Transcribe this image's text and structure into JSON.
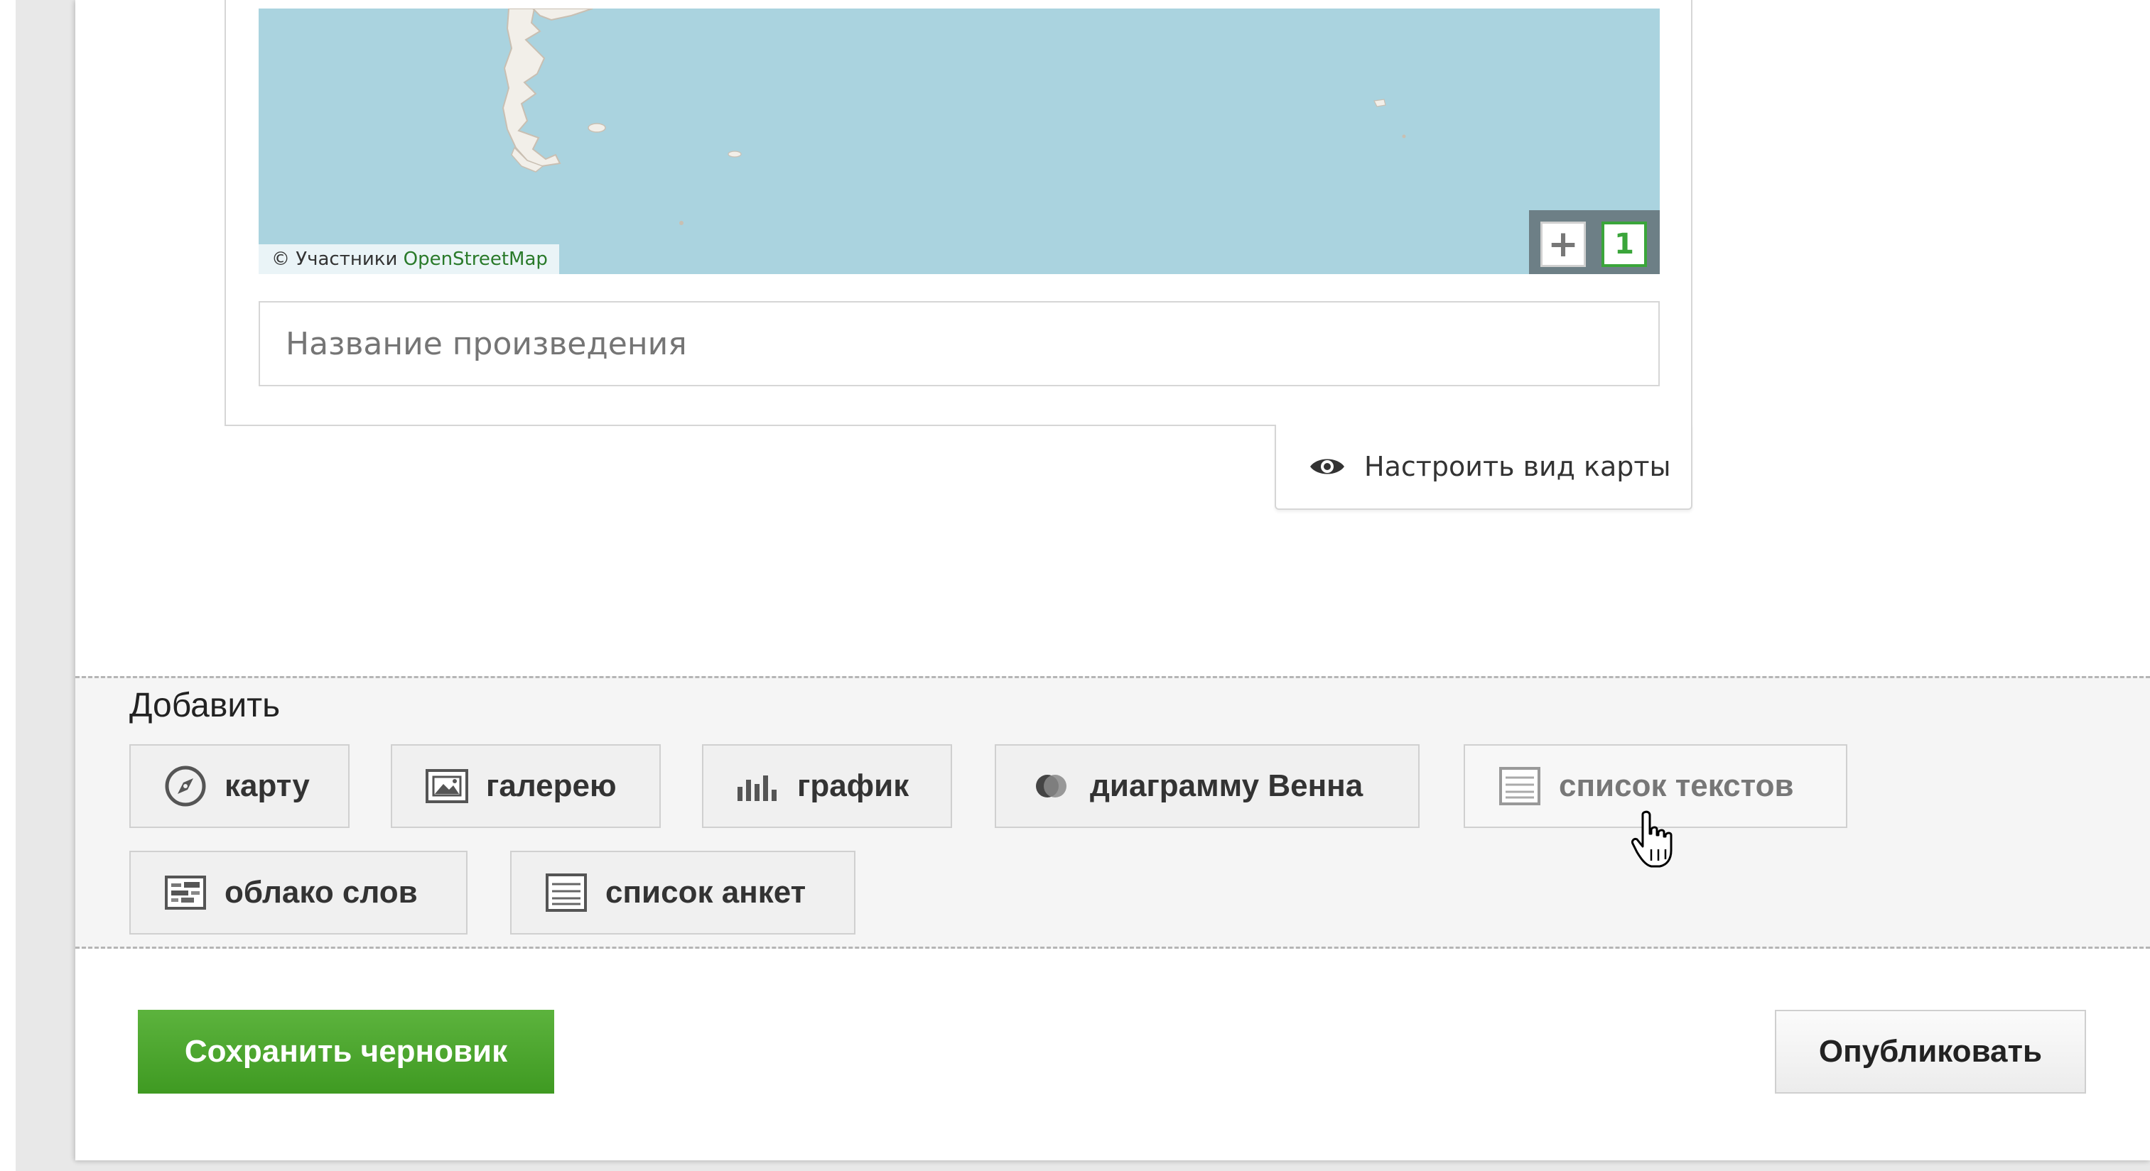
{
  "map": {
    "attribution_prefix": "© Участники",
    "attribution_link": "OpenStreetMap",
    "zoom_in": "+",
    "zoom_level": "1",
    "title_placeholder": "Название произведения",
    "settings_label": "Настроить вид карты",
    "settings_icon": "eye-icon"
  },
  "add_section": {
    "title": "Добавить",
    "buttons": [
      {
        "label": "карту",
        "icon": "compass-icon"
      },
      {
        "label": "галерею",
        "icon": "gallery-icon"
      },
      {
        "label": "график",
        "icon": "bar-chart-icon"
      },
      {
        "label": "диаграмму Венна",
        "icon": "venn-icon"
      },
      {
        "label": "список текстов",
        "icon": "text-list-icon"
      },
      {
        "label": "облако слов",
        "icon": "word-cloud-icon"
      },
      {
        "label": "список анкет",
        "icon": "survey-list-icon"
      }
    ]
  },
  "actions": {
    "save_draft": "Сохранить черновик",
    "publish": "Опубликовать"
  },
  "colors": {
    "water": "#aad3df",
    "land": "#f2efe9",
    "accent_green": "#4ca82e",
    "zoom_green": "#3aa53a"
  }
}
